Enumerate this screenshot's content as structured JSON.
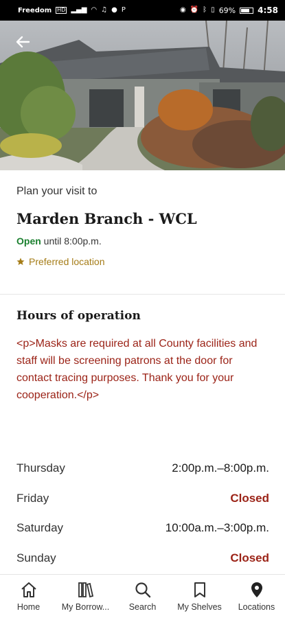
{
  "status_bar": {
    "carrier": "Freedom",
    "carrier_badge": "HD",
    "signal_text": "4G",
    "extra_icon": "P",
    "battery_percent": "69%",
    "time": "4:58"
  },
  "hero": {
    "back_icon": "arrow-left-icon"
  },
  "visit": {
    "pre_title": "Plan your visit to",
    "branch_name": "Marden Branch - WCL",
    "open_status": "Open",
    "open_until": " until 8:00p.m.",
    "preferred_label": "Preferred location"
  },
  "hours": {
    "title": "Hours of operation",
    "notice": "<p>Masks are required at all County facilities and staff will be screening patrons at the door for contact tracing purposes. Thank you for your cooperation.</p>",
    "rows": [
      {
        "day": "Thursday",
        "time": "2:00p.m.–8:00p.m.",
        "closed": false
      },
      {
        "day": "Friday",
        "time": "Closed",
        "closed": true
      },
      {
        "day": "Saturday",
        "time": "10:00a.m.–3:00p.m.",
        "closed": false
      },
      {
        "day": "Sunday",
        "time": "Closed",
        "closed": true
      }
    ]
  },
  "nav": {
    "items": [
      {
        "label": "Home",
        "icon": "home-icon"
      },
      {
        "label": "My Borrow...",
        "icon": "books-icon"
      },
      {
        "label": "Search",
        "icon": "search-icon"
      },
      {
        "label": "My Shelves",
        "icon": "bookmark-icon"
      },
      {
        "label": "Locations",
        "icon": "location-pin-icon"
      }
    ]
  },
  "colors": {
    "accent_red": "#9b2317",
    "open_green": "#1a7f2e",
    "preferred_gold": "#a57c17"
  }
}
